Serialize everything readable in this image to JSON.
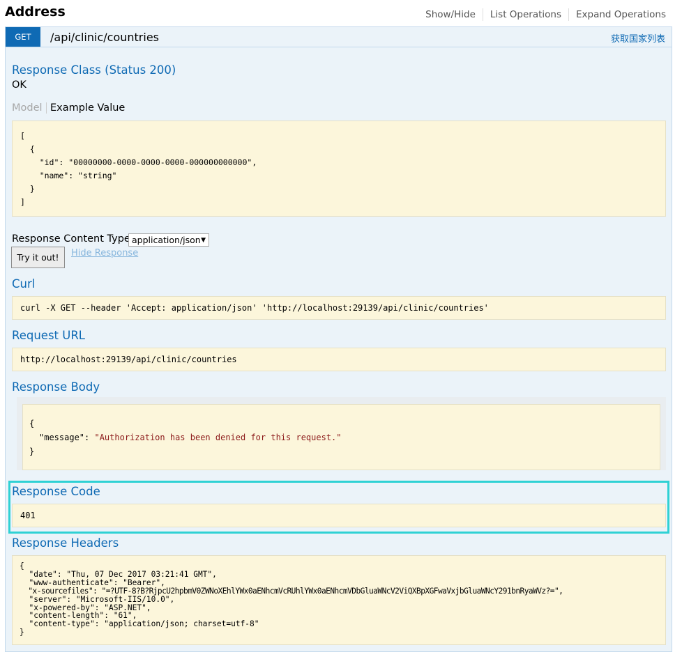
{
  "header": {
    "title": "Address",
    "links": [
      "Show/Hide",
      "List Operations",
      "Expand Operations"
    ]
  },
  "operation": {
    "method": "GET",
    "path": "/api/clinic/countries",
    "summary": "获取国家列表"
  },
  "response_class": {
    "heading": "Response Class (Status 200)",
    "status_text": "OK",
    "tab_model": "Model",
    "tab_example": "Example Value",
    "example_lines": [
      "[",
      "  {",
      "    \"id\": \"00000000-0000-0000-0000-000000000000\",",
      "    \"name\": \"string\"",
      "  }",
      "]"
    ]
  },
  "content_type": {
    "label": "Response Content Type",
    "selected": "application/json"
  },
  "buttons": {
    "try_it_out": "Try it out!",
    "hide_response": "Hide Response"
  },
  "curl": {
    "heading": "Curl",
    "command": "curl -X GET --header 'Accept: application/json' 'http://localhost:29139/api/clinic/countries'"
  },
  "request_url": {
    "heading": "Request URL",
    "url": "http://localhost:29139/api/clinic/countries"
  },
  "response_body": {
    "heading": "Response Body",
    "open": "{",
    "key": "\"message\"",
    "sep": ": ",
    "value": "\"Authorization has been denied for this request.\"",
    "close": "}"
  },
  "response_code": {
    "heading": "Response Code",
    "code": "401"
  },
  "response_headers": {
    "heading": "Response Headers",
    "lines": [
      "{",
      "  \"date\": \"Thu, 07 Dec 2017 03:21:41 GMT\",",
      "  \"www-authenticate\": \"Bearer\",",
      "  \"x-sourcefiles\": \"=?UTF-8?B?RjpcU2hpbmV0ZWNoXEhlYWx0aENhcmVcRUhlYWx0aENhcmVDbGluaWNcV2ViQXBpXGFwaVxjbGluaWNcY291bnRyaWVz?=\",",
      "  \"server\": \"Microsoft-IIS/10.0\",",
      "  \"x-powered-by\": \"ASP.NET\",",
      "  \"content-length\": \"61\",",
      "  \"content-type\": \"application/json; charset=utf-8\"",
      "}"
    ]
  }
}
